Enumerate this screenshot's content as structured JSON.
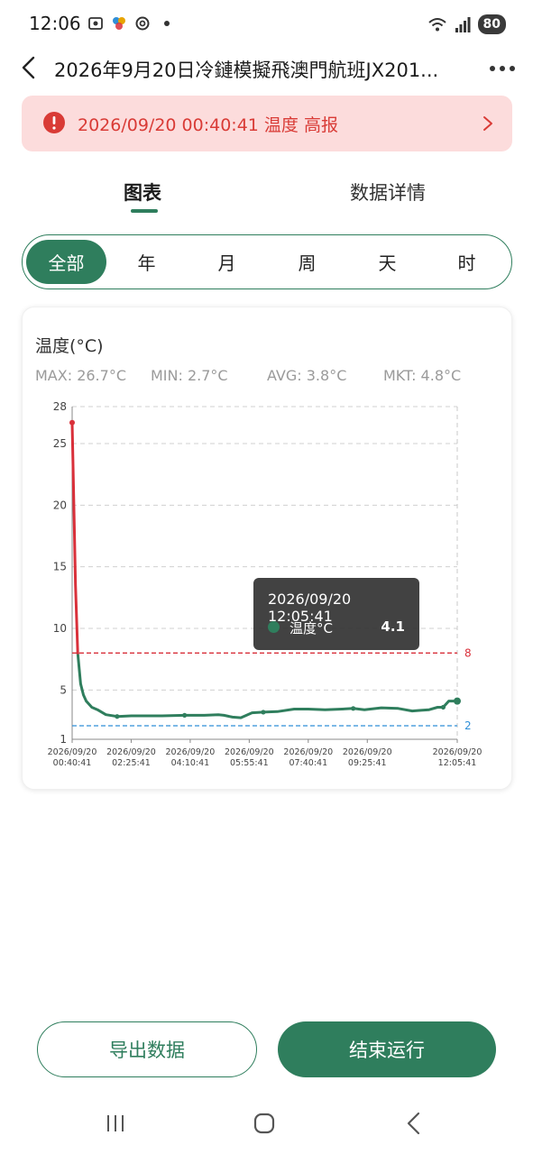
{
  "status_bar": {
    "time": "12:06",
    "battery": "80",
    "network": "5"
  },
  "header": {
    "title": "2026年9月20日冷鏈模擬飛澳門航班JX201..."
  },
  "alert": {
    "text": "2026/09/20 00:40:41 温度 高报"
  },
  "tabs": [
    {
      "label": "图表"
    },
    {
      "label": "数据详情"
    }
  ],
  "segments": [
    {
      "label": "全部"
    },
    {
      "label": "年"
    },
    {
      "label": "月"
    },
    {
      "label": "周"
    },
    {
      "label": "天"
    },
    {
      "label": "时"
    }
  ],
  "card": {
    "title": "温度(°C)",
    "stats": {
      "max": "MAX: 26.7°C",
      "min": "MIN: 2.7°C",
      "avg": "AVG: 3.8°C",
      "mkt": "MKT: 4.8°C"
    }
  },
  "tooltip": {
    "time": "2026/09/20 12:05:41",
    "label": "温度°C",
    "value": "4.1"
  },
  "buttons": {
    "export": "导出数据",
    "end": "结束运行"
  },
  "colors": {
    "primary": "#2f7e5d",
    "alert_bg": "#fcdcdc",
    "alert_text": "#d93b36",
    "high_limit": "#d9303a",
    "low_limit": "#2f8fd8"
  },
  "chart_data": {
    "type": "line",
    "ylim": [
      1,
      28
    ],
    "y_ticks": [
      1,
      5,
      10,
      15,
      20,
      25,
      28
    ],
    "x_ticks": [
      [
        "2026/09/20",
        "00:40:41"
      ],
      [
        "2026/09/20",
        "02:25:41"
      ],
      [
        "2026/09/20",
        "04:10:41"
      ],
      [
        "2026/09/20",
        "05:55:41"
      ],
      [
        "2026/09/20",
        "07:40:41"
      ],
      [
        "2026/09/20",
        "09:25:41"
      ],
      [
        "2026/09/20",
        "12:05:41"
      ]
    ],
    "x_range_minutes": [
      0,
      685
    ],
    "thresholds": [
      {
        "label": "8",
        "value": 8,
        "color": "#d9303a"
      },
      {
        "label": "2",
        "value": 2.1,
        "color": "#2f8fd8"
      }
    ],
    "series": [
      {
        "name": "温度°C",
        "color": "#2f7e5d",
        "high_color": "#d9303a",
        "x_minutes": [
          0,
          3,
          6,
          10,
          15,
          20,
          25,
          35,
          45,
          60,
          80,
          105,
          130,
          160,
          200,
          235,
          260,
          270,
          285,
          300,
          320,
          340,
          365,
          395,
          420,
          450,
          480,
          500,
          520,
          550,
          580,
          605,
          620,
          635,
          650,
          660,
          670,
          685
        ],
        "values": [
          26.7,
          20.0,
          13.5,
          8.0,
          5.5,
          4.6,
          4.1,
          3.6,
          3.4,
          3.0,
          2.85,
          2.9,
          2.9,
          2.9,
          2.95,
          2.95,
          3.0,
          2.95,
          2.8,
          2.75,
          3.15,
          3.2,
          3.25,
          3.45,
          3.45,
          3.4,
          3.45,
          3.5,
          3.4,
          3.55,
          3.5,
          3.3,
          3.35,
          3.4,
          3.6,
          3.6,
          4.1,
          4.1
        ]
      }
    ]
  }
}
